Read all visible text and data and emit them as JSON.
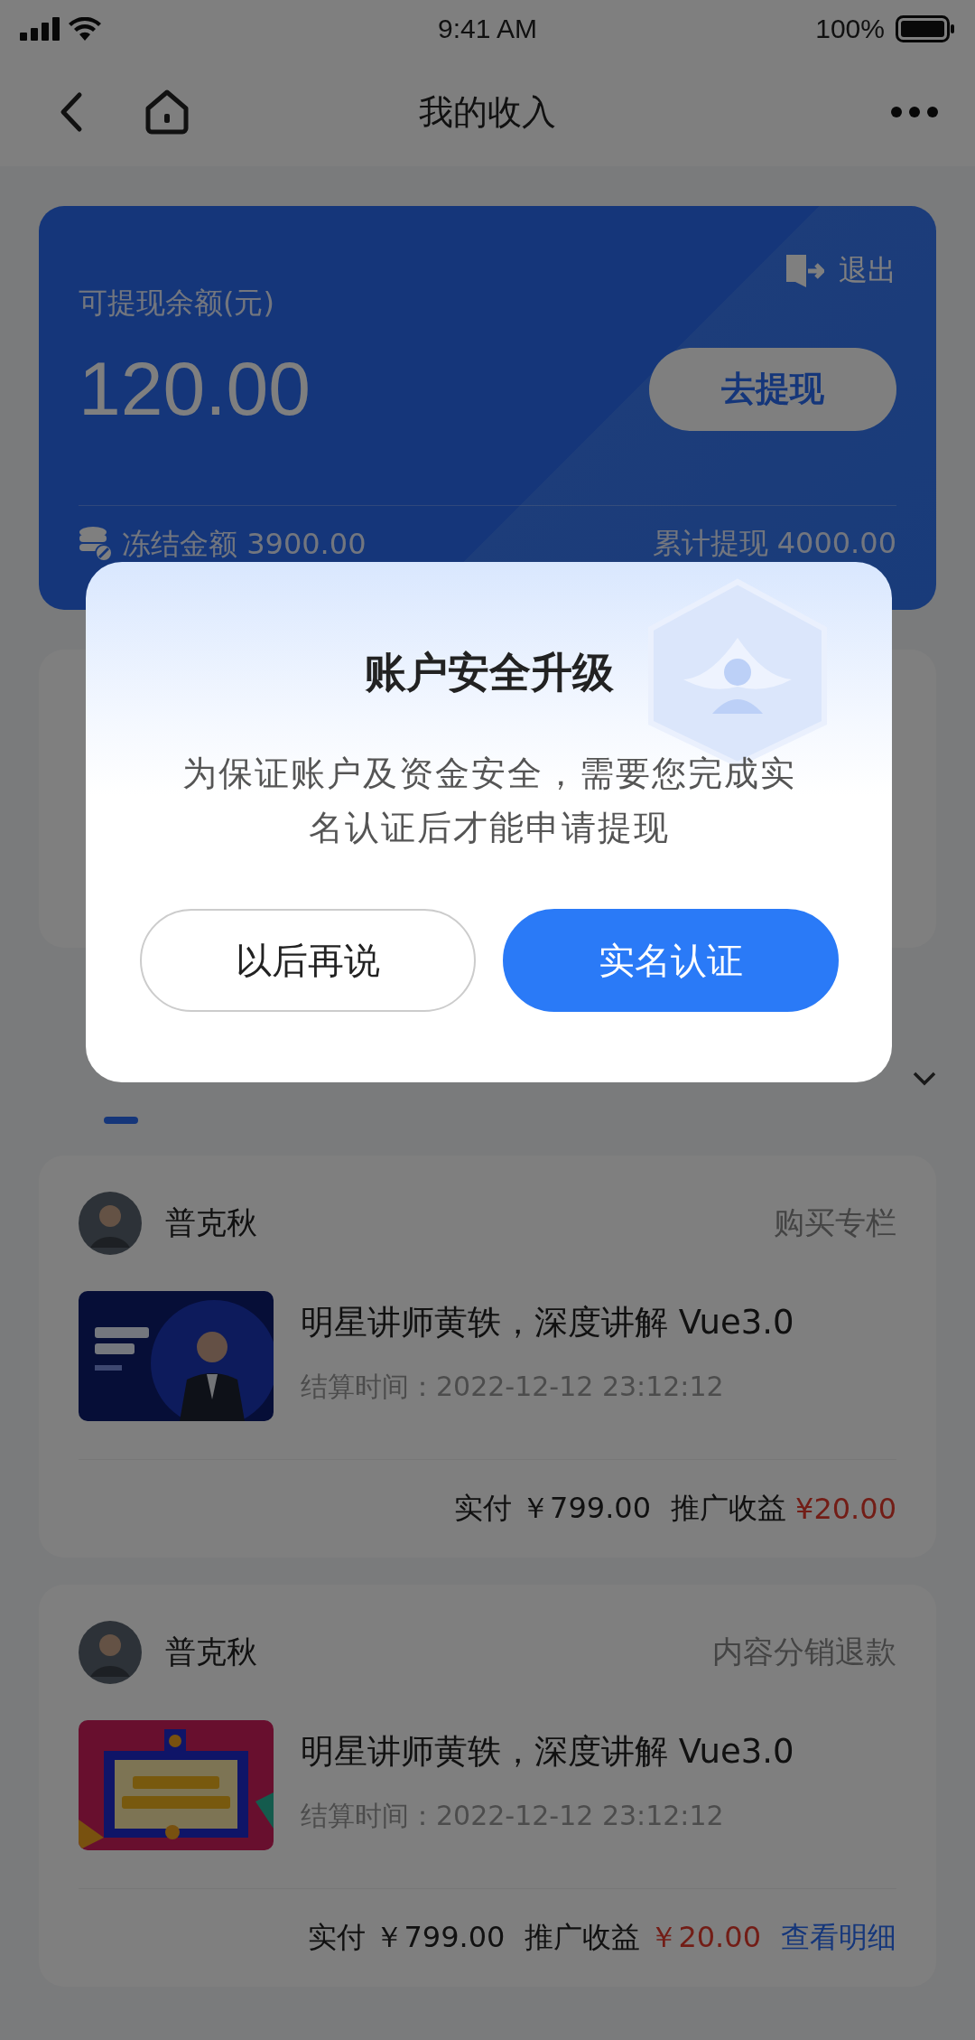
{
  "status_bar": {
    "time": "9:41 AM",
    "battery": "100%"
  },
  "nav": {
    "title": "我的收入"
  },
  "balance_card": {
    "label": "可提现余额(元)",
    "amount": "120.00",
    "exit": "退出",
    "withdraw_button": "去提现",
    "frozen": "冻结金额 3900.00",
    "total_withdrawn": "累计提现 4000.00"
  },
  "records": [
    {
      "user": "普克秋",
      "type": "购买专栏",
      "title": "明星讲师黄轶，深度讲解 Vue3.0",
      "settle_time": "结算时间：2022-12-12 23:12:12",
      "paid": "实付 ￥799.00",
      "earnings_label": "推广收益",
      "earnings": "¥20.00"
    },
    {
      "user": "普克秋",
      "type": "内容分销退款",
      "title": "明星讲师黄轶，深度讲解 Vue3.0",
      "settle_time": "结算时间：2022-12-12 23:12:12",
      "paid": "实付 ￥799.00",
      "earnings_label": "推广收益",
      "earnings": "￥20.00",
      "link": "查看明细"
    }
  ],
  "dialog": {
    "title": "账户安全升级",
    "message": "为保证账户及资金安全，需要您完成实名认证后才能申请提现",
    "buttons": [
      {
        "label": "以后再说",
        "kind": "secondary"
      },
      {
        "label": "实名认证",
        "kind": "primary"
      }
    ]
  }
}
